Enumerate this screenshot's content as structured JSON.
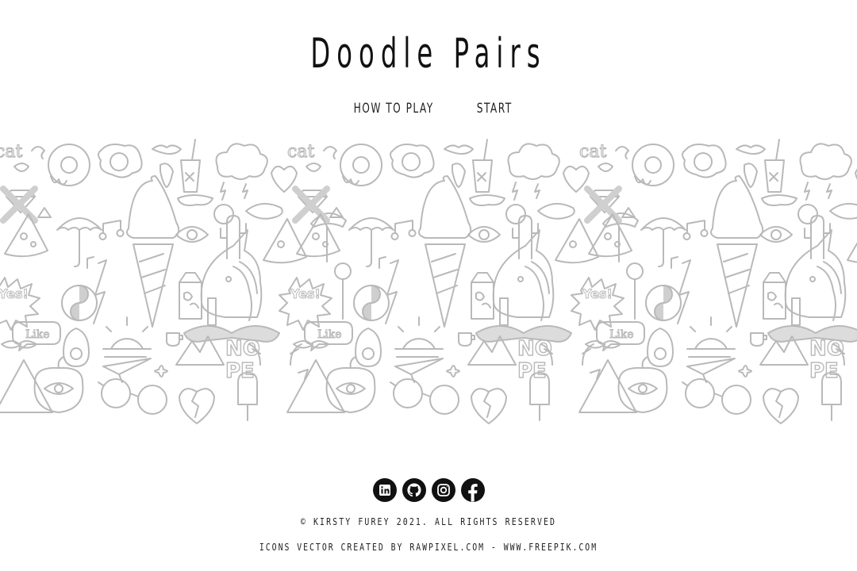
{
  "header": {
    "title": "Doodle Pairs"
  },
  "nav": {
    "how_to_play": "HOW TO PLAY",
    "start": "START"
  },
  "banner": {
    "doodle_texts": {
      "cat": "cat",
      "yes": "Yes!",
      "like": "Like",
      "no": "NO",
      "pe": "PE"
    }
  },
  "footer": {
    "social_icons": [
      "linkedin-icon",
      "github-icon",
      "instagram-icon",
      "facebook-icon"
    ],
    "copyright": "© KIRSTY FUREY 2021. ALL RIGHTS RESERVED",
    "credit": "ICONS VECTOR CREATED BY RAWPIXEL.COM - WWW.FREEPIK.COM"
  },
  "colors": {
    "background": "#ffffff",
    "text": "#111111",
    "doodle_stroke": "#b9b9b9",
    "icon_bg": "#111111"
  }
}
